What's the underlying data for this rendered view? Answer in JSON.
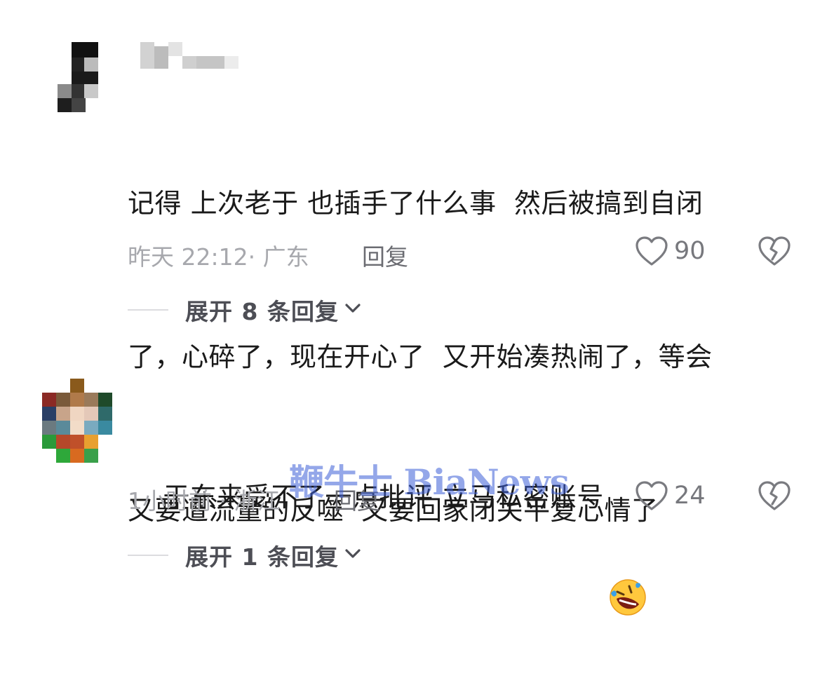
{
  "comments": [
    {
      "text_lines": [
        "记得 上次老于 也插手了什么事  然后被搞到自闭",
        "了，心碎了，现在开心了  又开始凑热闹了，等会",
        "又要遭流量的反噬  又要回家闭关平复心情了"
      ],
      "meta": "昨天 22:12· 广东",
      "reply_label": "回复",
      "likes": "90",
      "expand_label": "展开 8 条回复"
    },
    {
      "text_lines": [
        "于东来受不了一点批评 立马私密账号"
      ],
      "emoji": "rolling-on-floor-laughing",
      "meta": "1小时前 · 浙江",
      "reply_label": "回复",
      "likes": "24",
      "expand_label": "展开 1 条回复"
    }
  ],
  "watermark": "鞭牛士 BiaNews",
  "colors": {
    "text": "#1a1a1a",
    "meta": "#a7a8ad",
    "expand": "#4d4e55",
    "watermark": "#3c5fd7"
  },
  "icons": [
    "heart-icon",
    "broken-heart-icon",
    "chevron-down-icon"
  ]
}
